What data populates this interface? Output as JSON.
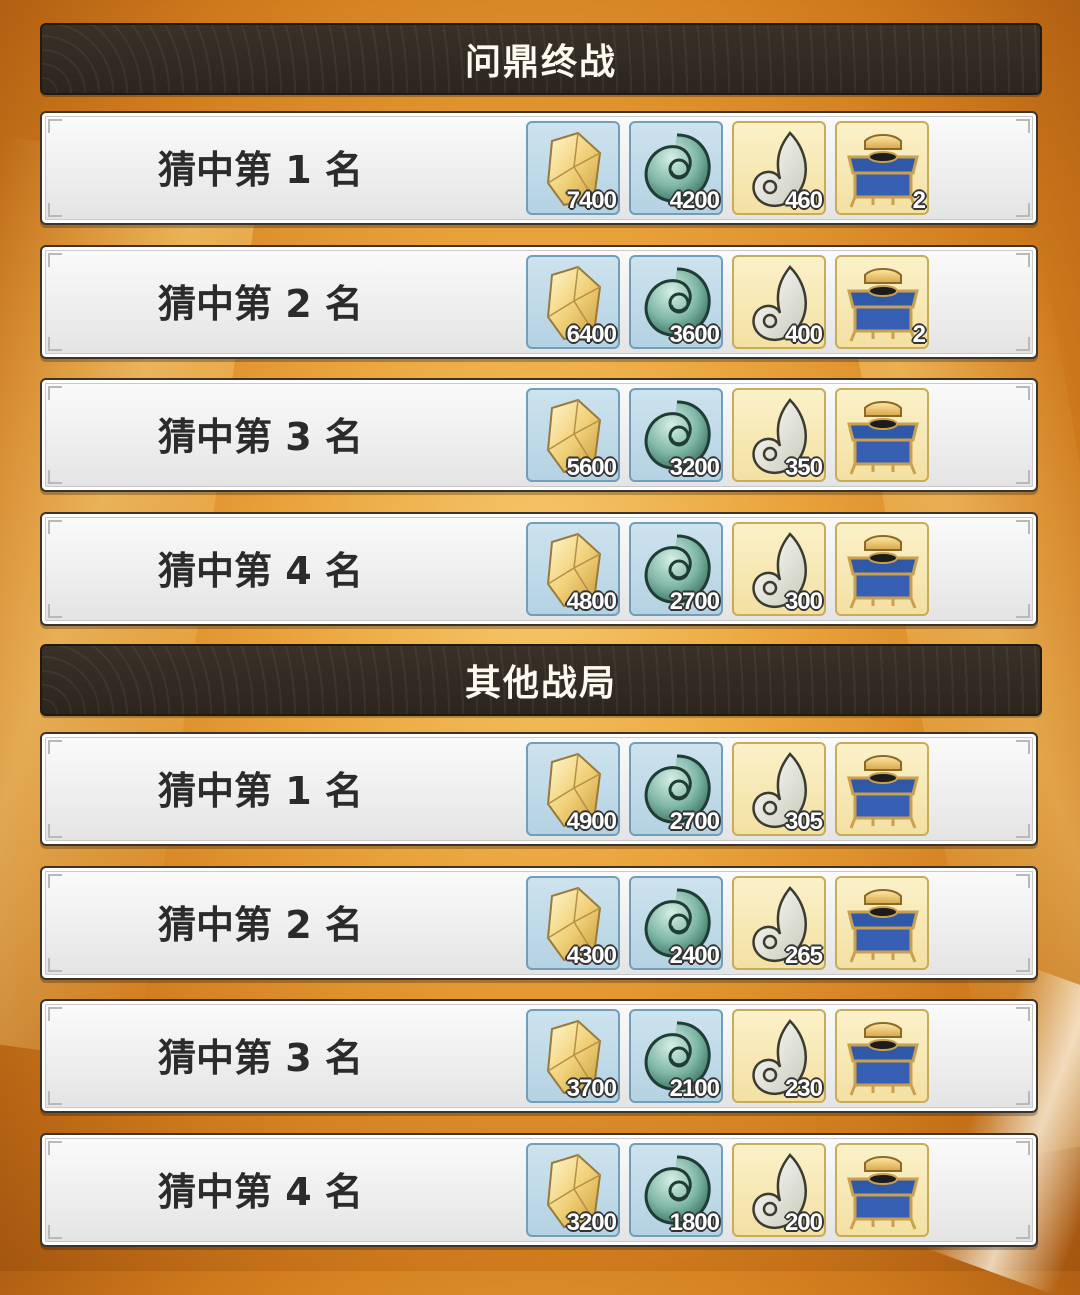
{
  "sections": [
    {
      "title": "问鼎终战",
      "rows": [
        {
          "label": "猜中第 1 名",
          "quantities": [
            "7400",
            "4200",
            "460",
            "2"
          ]
        },
        {
          "label": "猜中第 2 名",
          "quantities": [
            "6400",
            "3600",
            "400",
            "2"
          ]
        },
        {
          "label": "猜中第 3 名",
          "quantities": [
            "5600",
            "3200",
            "350",
            ""
          ]
        },
        {
          "label": "猜中第 4 名",
          "quantities": [
            "4800",
            "2700",
            "300",
            ""
          ]
        }
      ]
    },
    {
      "title": "其他战局",
      "rows": [
        {
          "label": "猜中第 1 名",
          "quantities": [
            "4900",
            "2700",
            "305",
            ""
          ]
        },
        {
          "label": "猜中第 2 名",
          "quantities": [
            "4300",
            "2400",
            "265",
            ""
          ]
        },
        {
          "label": "猜中第 3 名",
          "quantities": [
            "3700",
            "2100",
            "230",
            ""
          ]
        },
        {
          "label": "猜中第 4 名",
          "quantities": [
            "3200",
            "1800",
            "200",
            ""
          ]
        }
      ]
    }
  ],
  "item_icons": [
    "gold-crystal-icon",
    "jade-swirl-icon",
    "white-magatama-icon",
    "treasure-chest-icon"
  ],
  "colors": {
    "header_bg": "#2c251e",
    "header_text": "#fffaf0",
    "row_bg": "#f0f0f0",
    "item_blue_bg": "#c4dce9",
    "item_cream_bg": "#f6e6b0",
    "background_orange": "#e9a13a"
  }
}
